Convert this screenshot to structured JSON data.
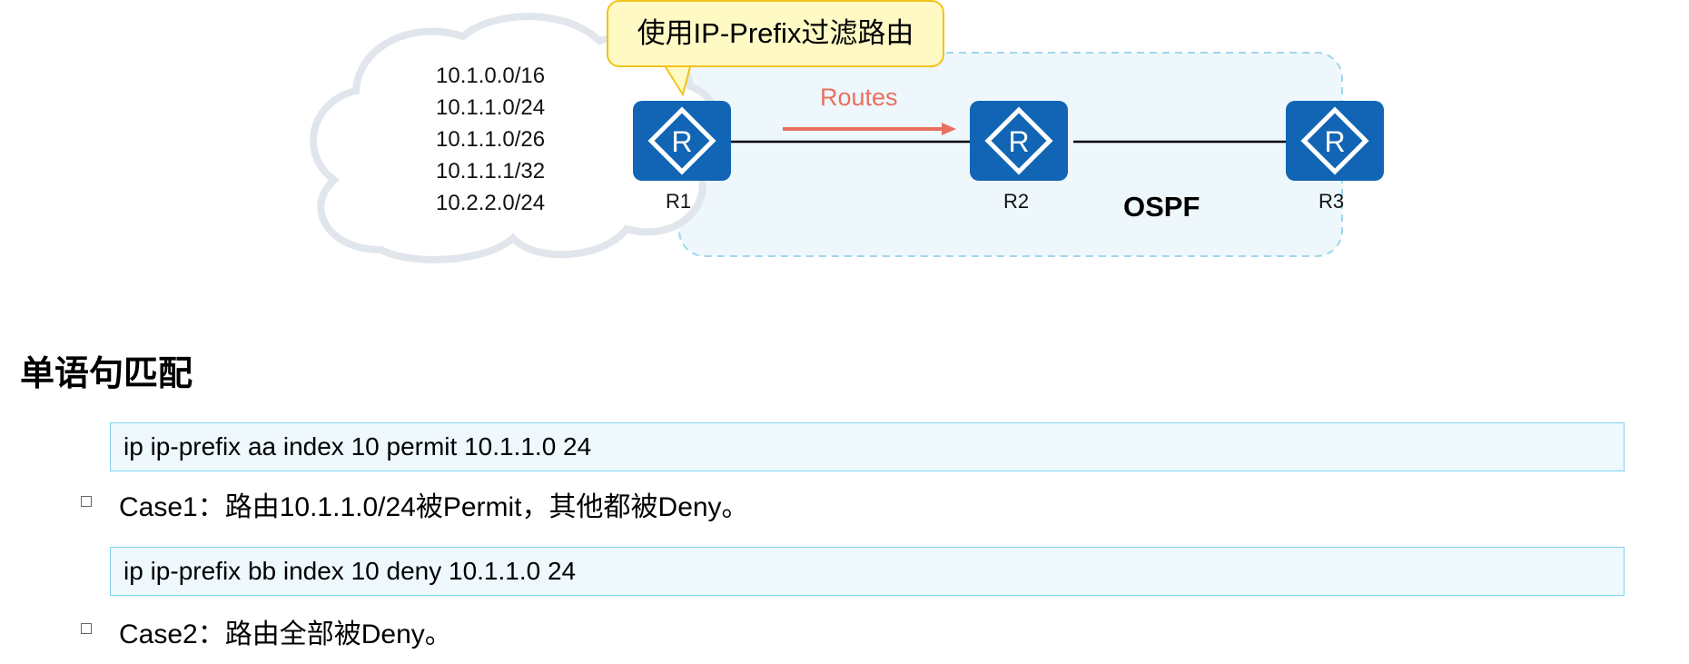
{
  "callout": {
    "text": "使用IP-Prefix过滤路由"
  },
  "cloud": {
    "routes": [
      "10.1.0.0/16",
      "10.1.1.0/24",
      "10.1.1.0/26",
      "10.1.1.1/32",
      "10.2.2.0/24"
    ]
  },
  "routers": [
    {
      "label": "R1"
    },
    {
      "label": "R2"
    },
    {
      "label": "R3"
    }
  ],
  "link": {
    "routes_label": "Routes"
  },
  "area": {
    "label": "OSPF"
  },
  "section": {
    "title": "单语句匹配"
  },
  "commands": [
    "ip ip-prefix aa index 10 permit 10.1.1.0 24",
    "ip ip-prefix bb index 10 deny 10.1.1.0 24"
  ],
  "cases": [
    "Case1：路由10.1.1.0/24被Permit，其他都被Deny。",
    "Case2：路由全部被Deny。"
  ],
  "colors": {
    "router": "#1165b4",
    "ospf_area_fill": "#eef7fc",
    "ospf_area_border": "#9fd6ee",
    "callout_fill": "#fff9c4",
    "callout_border": "#f2c21a",
    "routes_arrow": "#e8705f",
    "code_box_fill": "#eef8fd",
    "code_box_border": "#7fd3ee"
  }
}
